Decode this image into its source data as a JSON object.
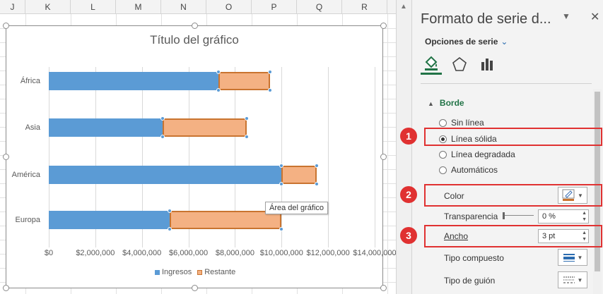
{
  "sheet": {
    "columns": [
      "J",
      "K",
      "L",
      "M",
      "N",
      "O",
      "P",
      "Q",
      "R"
    ]
  },
  "chart_data": {
    "type": "bar",
    "title": "Título del gráfico",
    "categories": [
      "África",
      "Asia",
      "América",
      "Europa"
    ],
    "series": [
      {
        "name": "Ingresos",
        "values": [
          7300000,
          4900000,
          10000000,
          5200000
        ],
        "color": "#5b9bd5"
      },
      {
        "name": "Restante",
        "values": [
          2200000,
          3600000,
          1500000,
          4800000
        ],
        "color": "#f4b183"
      }
    ],
    "stacked": true,
    "xlim": [
      0,
      14000000
    ],
    "tick_labels": [
      "$0",
      "$2,000,000",
      "$4,000,000",
      "$6,000,000",
      "$8,000,000",
      "$10,000,000",
      "$12,000,000",
      "$14,000,000"
    ],
    "grid": true,
    "legend_position": "bottom",
    "selected_series": "Restante"
  },
  "tooltip": "Área del gráfico",
  "pane": {
    "title": "Formato de serie d...",
    "close_glyph": "✕",
    "dropdown_glyph": "▼",
    "series_options_label": "Opciones de serie",
    "section_label": "Borde",
    "radio_options": [
      {
        "label": "Sin línea",
        "selected": false
      },
      {
        "label": "Línea sólida",
        "selected": true
      },
      {
        "label": "Línea degradada",
        "selected": false
      },
      {
        "label": "Automáticos",
        "selected": false
      }
    ],
    "color_label": "Color",
    "transparency_label": "Transparencia",
    "transparency_value": "0 %",
    "width_label": "Ancho",
    "width_value": "3 pt",
    "compound_label": "Tipo compuesto",
    "dash_label": "Tipo de guión"
  },
  "badges": [
    "1",
    "2",
    "3"
  ],
  "colors": {
    "accent_green": "#217346",
    "highlight_red": "#e03131",
    "border_orange": "#c97430"
  }
}
